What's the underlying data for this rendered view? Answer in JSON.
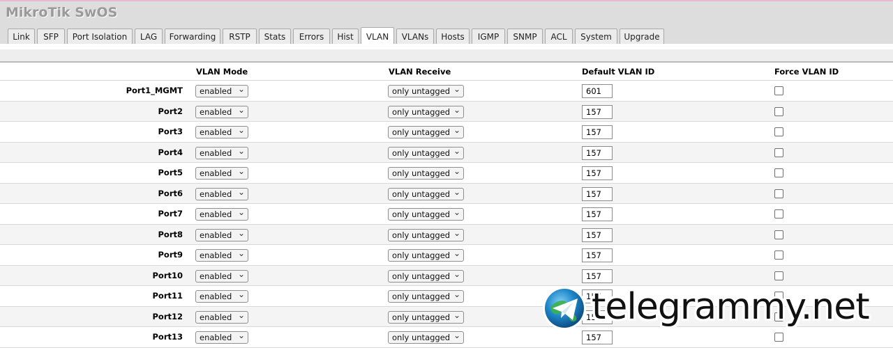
{
  "app": {
    "title": "MikroTik SwOS"
  },
  "tabs": [
    {
      "label": "Link",
      "active": false
    },
    {
      "label": "SFP",
      "active": false
    },
    {
      "label": "Port Isolation",
      "active": false
    },
    {
      "label": "LAG",
      "active": false
    },
    {
      "label": "Forwarding",
      "active": false
    },
    {
      "label": "RSTP",
      "active": false
    },
    {
      "label": "Stats",
      "active": false
    },
    {
      "label": "Errors",
      "active": false
    },
    {
      "label": "Hist",
      "active": false
    },
    {
      "label": "VLAN",
      "active": true
    },
    {
      "label": "VLANs",
      "active": false
    },
    {
      "label": "Hosts",
      "active": false
    },
    {
      "label": "IGMP",
      "active": false
    },
    {
      "label": "SNMP",
      "active": false
    },
    {
      "label": "ACL",
      "active": false
    },
    {
      "label": "System",
      "active": false
    },
    {
      "label": "Upgrade",
      "active": false
    }
  ],
  "table": {
    "columns": {
      "vlan_mode": "VLAN Mode",
      "vlan_receive": "VLAN Receive",
      "default_vlan_id": "Default VLAN ID",
      "force_vlan_id": "Force VLAN ID"
    },
    "rows": [
      {
        "port": "Port1_MGMT",
        "mode": "enabled",
        "receive": "only untagged",
        "vid": "601",
        "force": false
      },
      {
        "port": "Port2",
        "mode": "enabled",
        "receive": "only untagged",
        "vid": "157",
        "force": false
      },
      {
        "port": "Port3",
        "mode": "enabled",
        "receive": "only untagged",
        "vid": "157",
        "force": false
      },
      {
        "port": "Port4",
        "mode": "enabled",
        "receive": "only untagged",
        "vid": "157",
        "force": false
      },
      {
        "port": "Port5",
        "mode": "enabled",
        "receive": "only untagged",
        "vid": "157",
        "force": false
      },
      {
        "port": "Port6",
        "mode": "enabled",
        "receive": "only untagged",
        "vid": "157",
        "force": false
      },
      {
        "port": "Port7",
        "mode": "enabled",
        "receive": "only untagged",
        "vid": "157",
        "force": false
      },
      {
        "port": "Port8",
        "mode": "enabled",
        "receive": "only untagged",
        "vid": "157",
        "force": false
      },
      {
        "port": "Port9",
        "mode": "enabled",
        "receive": "only untagged",
        "vid": "157",
        "force": false
      },
      {
        "port": "Port10",
        "mode": "enabled",
        "receive": "only untagged",
        "vid": "157",
        "force": false
      },
      {
        "port": "Port11",
        "mode": "enabled",
        "receive": "only untagged",
        "vid": "157",
        "force": false
      },
      {
        "port": "Port12",
        "mode": "enabled",
        "receive": "only untagged",
        "vid": "157",
        "force": false
      },
      {
        "port": "Port13",
        "mode": "enabled",
        "receive": "only untagged",
        "vid": "157",
        "force": false
      }
    ]
  },
  "watermark": {
    "text": "telegrammy.net",
    "icon": "telegram-globe-icon"
  },
  "colors": {
    "header_bg": "#dddddd",
    "accent_line": "#e9b7cf"
  }
}
